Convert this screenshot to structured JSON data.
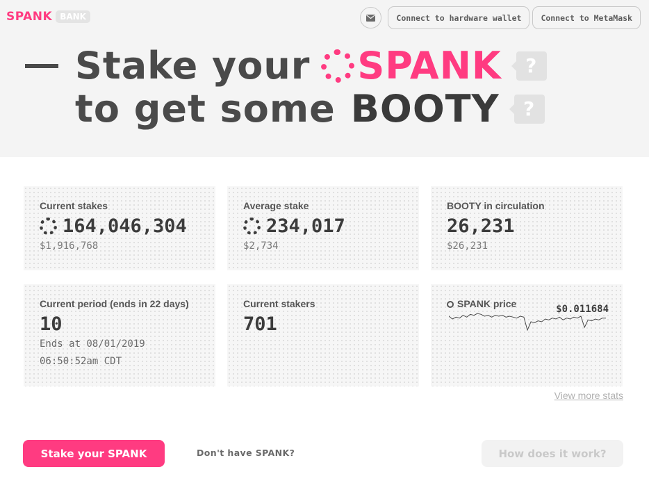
{
  "header": {
    "logo_brand": "SPANK",
    "logo_badge": "BANK",
    "mail_icon": "envelope-icon",
    "hardware_wallet_label": "Connect to hardware wallet",
    "metamask_label": "Connect to MetaMask"
  },
  "hero": {
    "line1_prefix": "Stake your",
    "line1_token": "SPANK",
    "line2_prefix": "to get some",
    "line2_token": "BOOTY",
    "help_glyph": "?"
  },
  "stats": {
    "current_stakes": {
      "label": "Current stakes",
      "value": "164,046,304",
      "sub": "$1,916,768"
    },
    "average_stake": {
      "label": "Average stake",
      "value": "234,017",
      "sub": "$2,734"
    },
    "booty_circulation": {
      "label": "BOOTY in circulation",
      "value": "26,231",
      "sub": "$26,231"
    },
    "current_period": {
      "label": "Current period (ends in 22 days)",
      "value": "10",
      "ends_date": "Ends at 08/01/2019",
      "ends_time": "06:50:52am CDT"
    },
    "current_stakers": {
      "label": "Current stakers",
      "value": "701"
    },
    "spank_price": {
      "label": "SPANK price",
      "value": "$0.011684",
      "history": [
        0.01185,
        0.01182,
        0.01184,
        0.01183,
        0.01186,
        0.01184,
        0.01187,
        0.01186,
        0.01188,
        0.01187,
        0.01185,
        0.01186,
        0.01184,
        0.01186,
        0.01185,
        0.01186,
        0.01184,
        0.01185,
        0.01184,
        0.01183,
        0.01185,
        0.01184,
        0.0117,
        0.01179,
        0.01178,
        0.0118,
        0.01179,
        0.01182,
        0.01181,
        0.01183,
        0.01182,
        0.01184,
        0.01181,
        0.01183,
        0.01182,
        0.01184,
        0.01183,
        0.01185,
        0.01173,
        0.01181,
        0.0118,
        0.01182,
        0.01181,
        0.01183,
        0.01183
      ]
    }
  },
  "links": {
    "view_more_stats": "View more stats"
  },
  "actions": {
    "stake_label": "Stake your SPANK",
    "no_spank_label": "Don't have SPANK?",
    "how_label": "How does it work?"
  },
  "colors": {
    "accent": "#ff3b81",
    "text": "#3d3d3d",
    "hero_bg": "#f4f4f4"
  }
}
